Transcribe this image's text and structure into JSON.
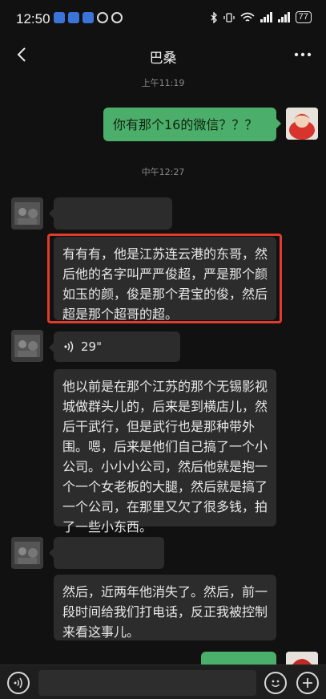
{
  "status_bar": {
    "time": "12:50",
    "battery": "77",
    "network": "4G"
  },
  "header": {
    "title": "巴桑"
  },
  "messages": {
    "ts1": "上午11:19",
    "m1_text": "你有那个16的微信？？？",
    "ts2": "中午12:27",
    "m3_text": "有有有，他是江苏连云港的东哥，然后他的名字叫严严俊超，严是那个颜如玉的颜，俊是那个君宝的俊，然后超是那个超哥的超。",
    "m4_duration": "29\"",
    "m5_text": "他以前是在那个江苏的那个无锡影视城做群头儿的，后来是到横店儿，然后干武行，但是武行也是那种带外围。嗯，后来是他们自己搞了一个小公司。小小小公司，然后他就是抱一个一个女老板的大腿，然后就是搞了一个公司，在那里又欠了很多钱，拍了一些小东西。",
    "m7_text": "然后，近两年他消失了。然后，前一段时间给我们打电话，反正我被控制来看这事儿。"
  },
  "colors": {
    "background": "#111111",
    "incoming_bubble": "#2c2c2c",
    "outgoing_bubble": "#4cae6b",
    "highlight_box": "#e23a2b"
  },
  "icons": {
    "back": "chevron-left-icon",
    "more": "more-dots-icon",
    "voice_wave": "voice-wave-icon",
    "voice_toggle": "voice-input-icon",
    "emoji": "emoji-icon",
    "plus": "plus-icon"
  }
}
